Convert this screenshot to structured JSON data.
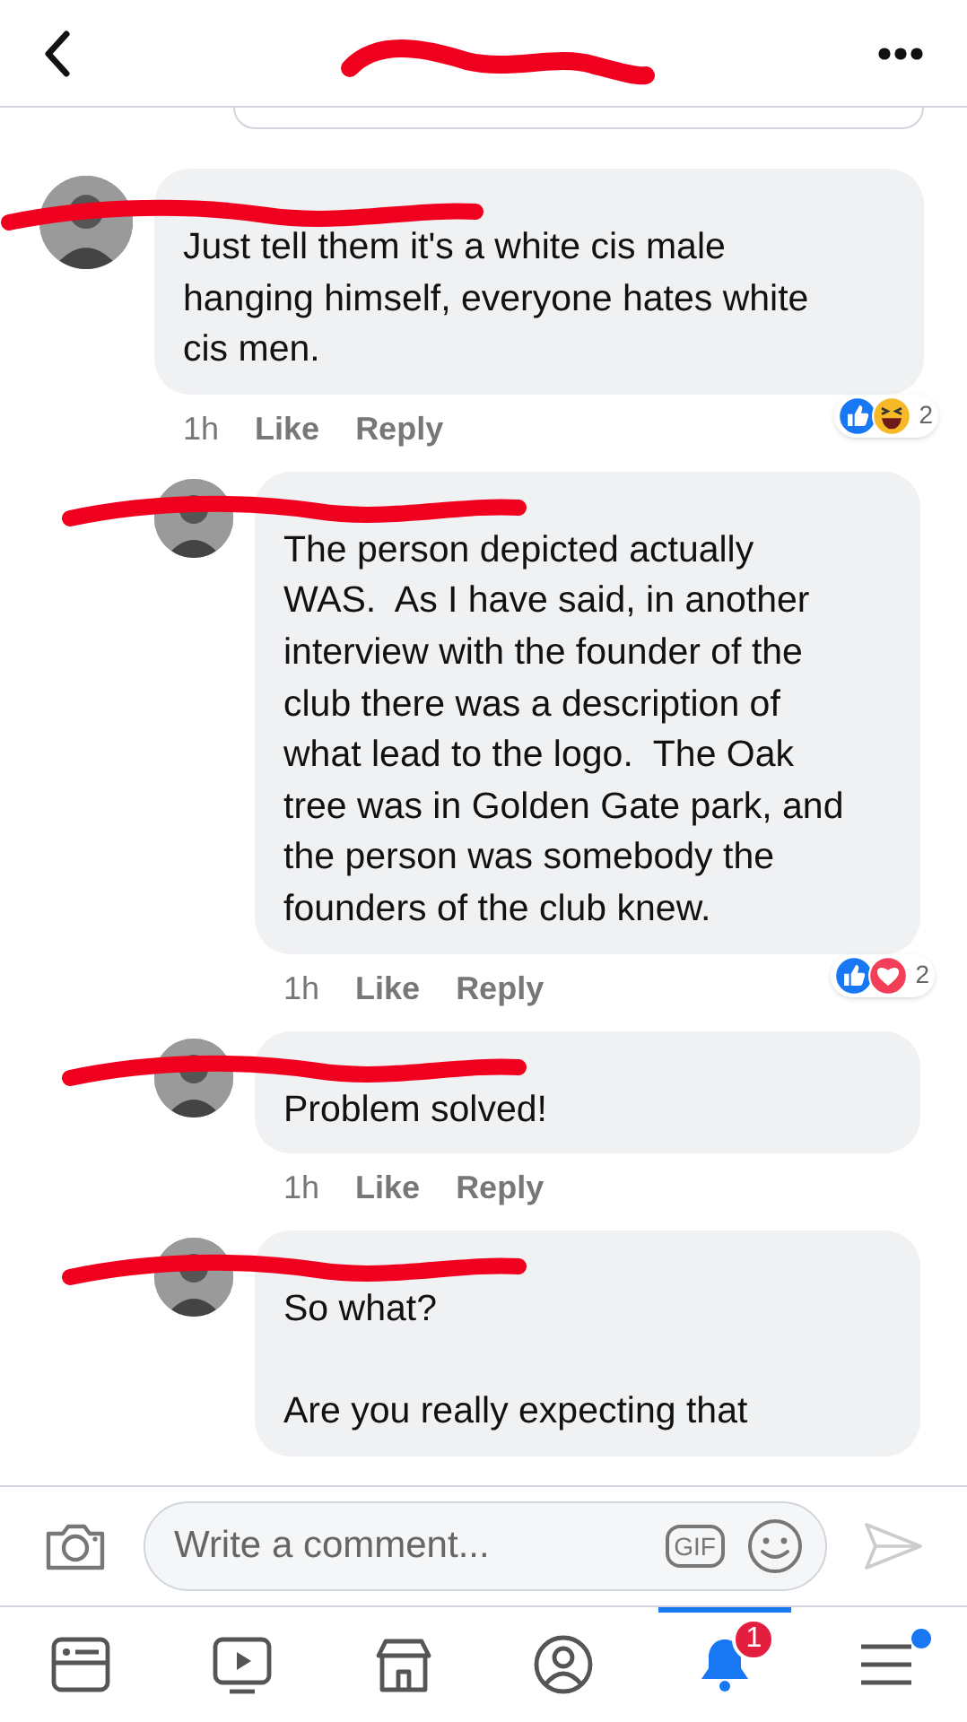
{
  "comments": [
    {
      "text": "Just tell them it's a white cis male\nhanging himself, everyone hates white\ncis men.",
      "time": "1h",
      "like": "Like",
      "reply": "Reply",
      "reactions": {
        "kinds": [
          {
            "kind": "like"
          },
          {
            "kind": "haha"
          }
        ],
        "count": "2"
      },
      "replies": [
        {
          "text": "The person depicted actually\nWAS.  As I have said, in another\ninterview with the founder of the\nclub there was a description of\nwhat lead to the logo.  The Oak\ntree was in Golden Gate park, and\nthe person was somebody the\nfounders of the club knew.",
          "time": "1h",
          "like": "Like",
          "reply": "Reply",
          "reactions": {
            "kinds": [
              {
                "kind": "like"
              },
              {
                "kind": "love"
              }
            ],
            "count": "2"
          }
        },
        {
          "text": "Problem solved!",
          "time": "1h",
          "like": "Like",
          "reply": "Reply"
        },
        {
          "text": "So what?\n\nAre you really expecting that"
        }
      ]
    }
  ],
  "composer": {
    "placeholder": "Write a comment...",
    "gif_label": "GIF"
  },
  "nav": [
    {
      "kind": "feed",
      "selected": false
    },
    {
      "kind": "watch",
      "selected": false
    },
    {
      "kind": "marketplace",
      "selected": false
    },
    {
      "kind": "profile",
      "selected": false
    },
    {
      "kind": "notifications",
      "selected": true,
      "badge": "1"
    },
    {
      "kind": "menu",
      "selected": false,
      "has_update": true
    }
  ]
}
